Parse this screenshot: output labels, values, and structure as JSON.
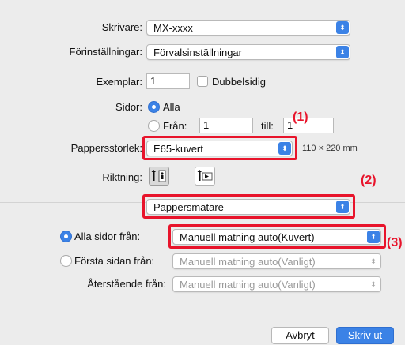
{
  "printer": {
    "label": "Skrivare:",
    "value": "MX-xxxx"
  },
  "presets": {
    "label": "Förinställningar:",
    "value": "Förvalsinställningar"
  },
  "copies": {
    "label": "Exemplar:",
    "value": "1",
    "duplex_label": "Dubbelsidig"
  },
  "pages": {
    "label": "Sidor:",
    "all_label": "Alla",
    "from_label": "Från:",
    "from_value": "1",
    "to_label": "till:",
    "to_value": "1"
  },
  "paper_size": {
    "label": "Pappersstorlek:",
    "value": "E65-kuvert",
    "dimensions": "110 × 220 mm"
  },
  "orientation": {
    "label": "Riktning:"
  },
  "section_menu": {
    "value": "Pappersmatare"
  },
  "feed": {
    "all_pages_label": "Alla sidor från:",
    "all_pages_value": "Manuell matning auto(Kuvert)",
    "first_page_label": "Första sidan från:",
    "first_page_value": "Manuell matning auto(Vanligt)",
    "remaining_label": "Återstående från:",
    "remaining_value": "Manuell matning auto(Vanligt)"
  },
  "buttons": {
    "cancel": "Avbryt",
    "print": "Skriv ut"
  },
  "callouts": {
    "c1": "(1)",
    "c2": "(2)",
    "c3": "(3)"
  },
  "colors": {
    "accent": "#3b82e6",
    "highlight": "#e8142b"
  }
}
